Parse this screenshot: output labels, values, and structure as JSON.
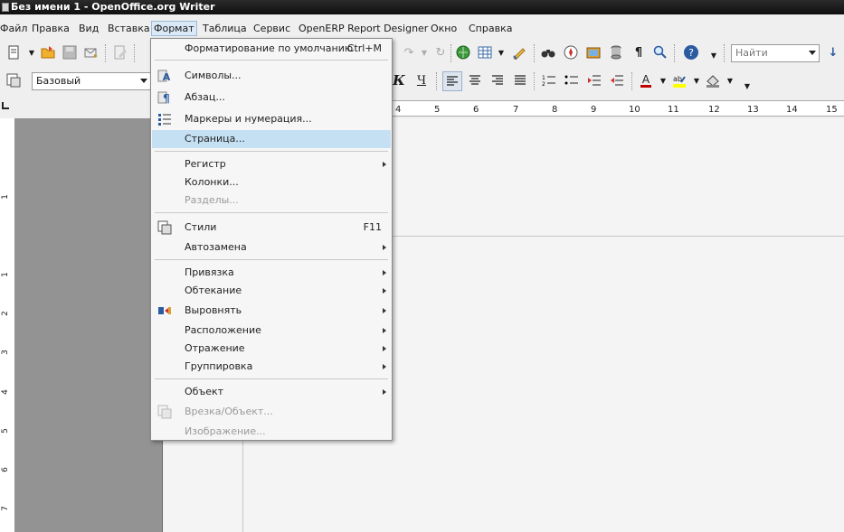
{
  "window": {
    "title": "Без имени 1 - OpenOffice.org Writer"
  },
  "menubar": {
    "items": [
      {
        "label": "Файл"
      },
      {
        "label": "Правка"
      },
      {
        "label": "Вид"
      },
      {
        "label": "Вставка"
      },
      {
        "label": "Формат"
      },
      {
        "label": "Таблица"
      },
      {
        "label": "Сервис"
      },
      {
        "label": "OpenERP Report Designer"
      },
      {
        "label": "Окно"
      },
      {
        "label": "Справка"
      }
    ],
    "active": "Формат"
  },
  "toolbar": {
    "search_placeholder": "Найти",
    "style_value": "Базовый",
    "bold_label": "К",
    "underline_label": "Ч"
  },
  "ruler": {
    "ticks": [
      "4",
      "5",
      "6",
      "7",
      "8",
      "9",
      "10",
      "11",
      "12",
      "13",
      "14",
      "15"
    ]
  },
  "vruler": {
    "ticks": [
      "1",
      "1",
      "2",
      "3",
      "4",
      "5",
      "6",
      "7"
    ]
  },
  "format_menu": {
    "items": [
      {
        "label": "Форматирование по умолчанию",
        "shortcut": "Ctrl+M",
        "icon": ""
      },
      {
        "label": "Символы...",
        "icon": "character-icon"
      },
      {
        "label": "Абзац...",
        "icon": "paragraph-icon"
      },
      {
        "label": "Маркеры и нумерация...",
        "icon": "bullets-icon"
      },
      {
        "label": "Страница...",
        "icon": "",
        "highlighted": true
      },
      {
        "label": "Регистр",
        "submenu": true
      },
      {
        "label": "Колонки..."
      },
      {
        "label": "Разделы...",
        "disabled": true
      },
      {
        "label": "Стили",
        "shortcut": "F11",
        "icon": "styles-icon"
      },
      {
        "label": "Автозамена",
        "submenu": true
      },
      {
        "label": "Привязка",
        "submenu": true
      },
      {
        "label": "Обтекание",
        "submenu": true
      },
      {
        "label": "Выровнять",
        "submenu": true,
        "icon": "align-icon"
      },
      {
        "label": "Расположение",
        "submenu": true
      },
      {
        "label": "Отражение",
        "submenu": true
      },
      {
        "label": "Группировка",
        "submenu": true
      },
      {
        "label": "Объект",
        "submenu": true
      },
      {
        "label": "Врезка/Объект...",
        "disabled": true,
        "icon": "frame-icon"
      },
      {
        "label": "Изображение...",
        "disabled": true
      }
    ]
  },
  "colors": {
    "highlight": "#c6e0f3",
    "menu_bg": "#f6f6f6",
    "page_bg": "#939393"
  }
}
